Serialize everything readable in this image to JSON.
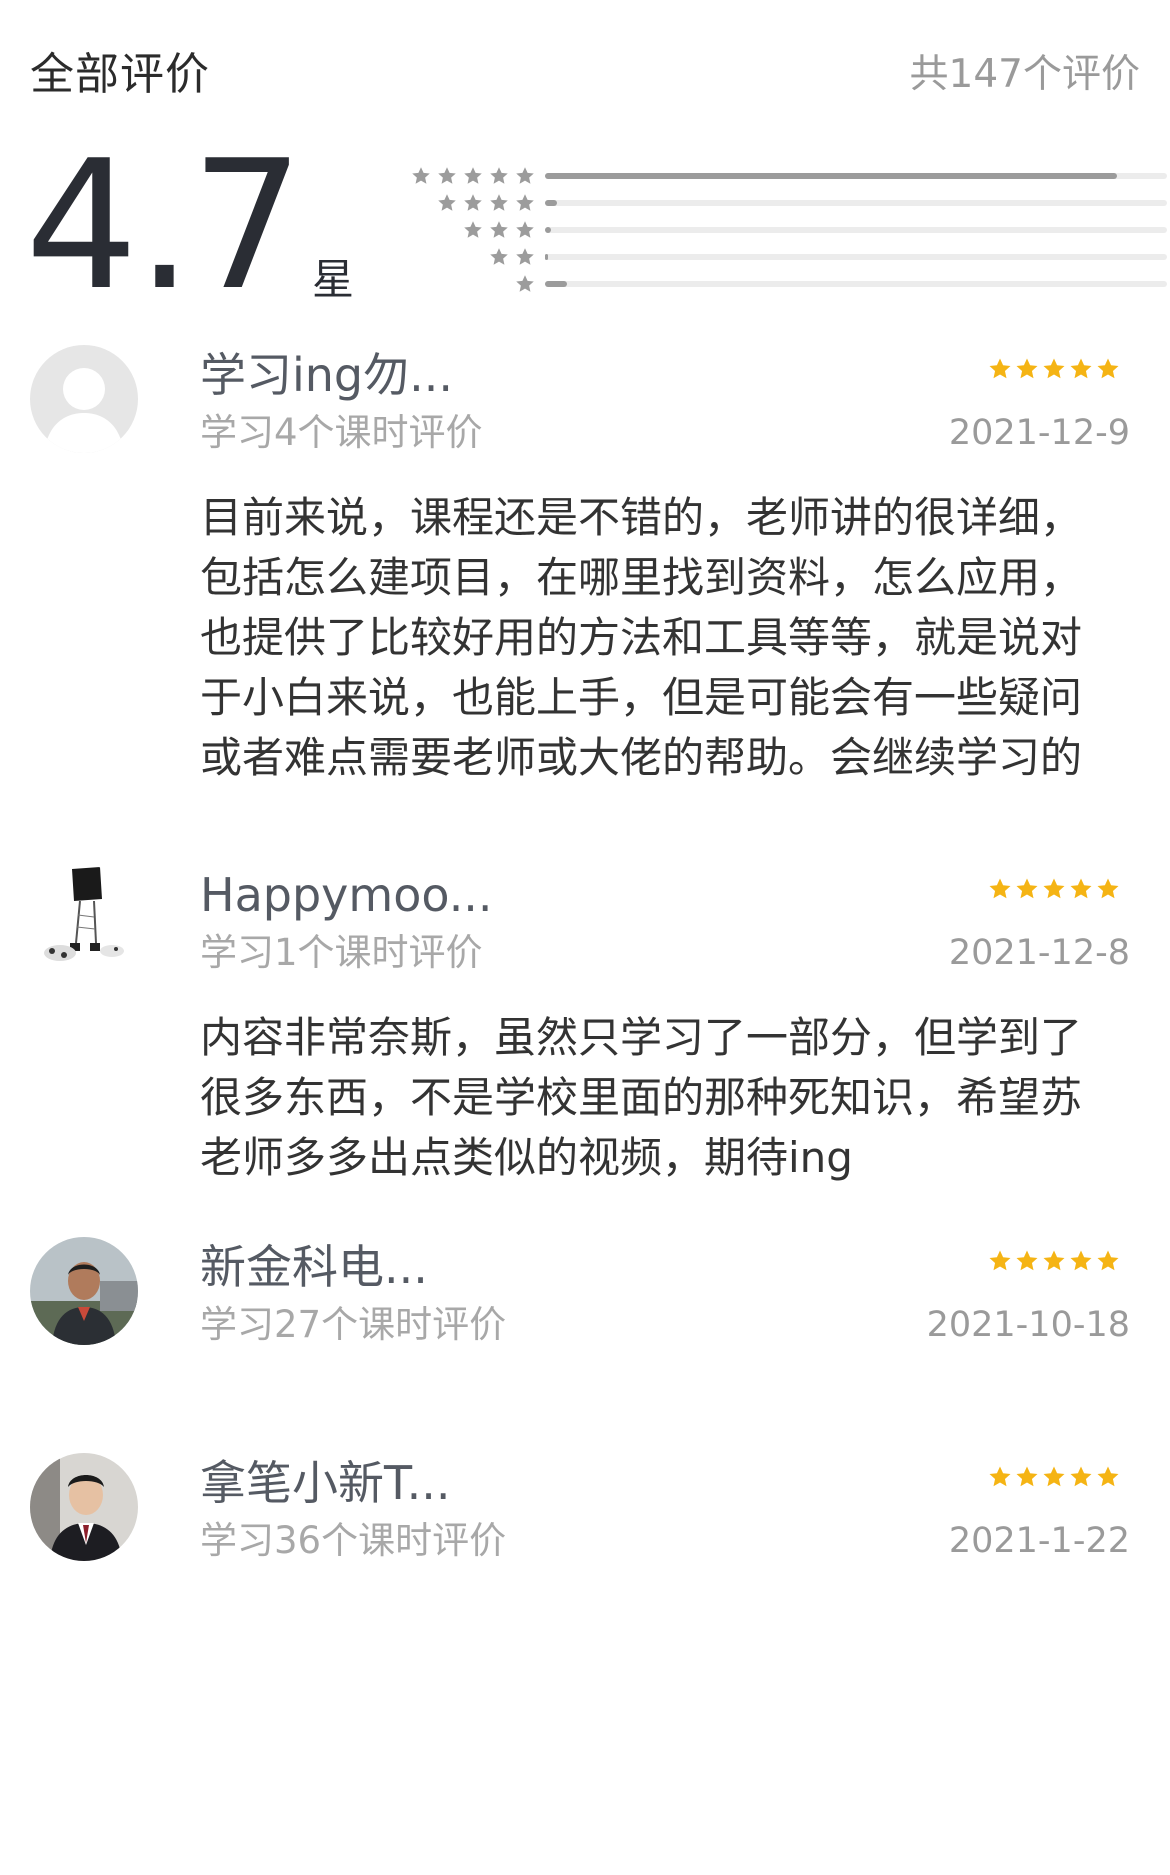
{
  "header": {
    "title": "全部评价",
    "count": "共147个评价"
  },
  "summary": {
    "score": "4.7",
    "unit": "星",
    "distribution": [
      {
        "stars": 5,
        "fraction": 0.92
      },
      {
        "stars": 4,
        "fraction": 0.02
      },
      {
        "stars": 3,
        "fraction": 0.01
      },
      {
        "stars": 2,
        "fraction": 0.005
      },
      {
        "stars": 1,
        "fraction": 0.035
      }
    ]
  },
  "colors": {
    "star_gold": "#f5b414",
    "mini_star_grey": "#9c9c9c",
    "bar_fill": "#9b9b9b",
    "bar_track": "#ececec"
  },
  "reviews": [
    {
      "name": "学习ing勿...",
      "avatar_icon": "default-user-icon",
      "rating": 5,
      "study": "学习4个课时评价",
      "date": "2021-12-9",
      "text": "目前来说，课程还是不错的，老师讲的很详细，包括怎么建项目，在哪里找到资料，怎么应用，也提供了比较好用的方法和工具等等，就是说对于小白来说，也能上手，但是可能会有一些疑问或者难点需要老师或大佬的帮助。会继续学习的"
    },
    {
      "name": "Happymoo...",
      "avatar_icon": "sketch-figure-icon",
      "rating": 5,
      "study": "学习1个课时评价",
      "date": "2021-12-8",
      "text": "内容非常奈斯，虽然只学习了一部分，但学到了很多东西，不是学校里面的那种死知识，希望苏老师多多出点类似的视频，期待ing"
    },
    {
      "name": "新金科电...",
      "avatar_icon": "user-photo-icon",
      "rating": 5,
      "study": "学习27个课时评价",
      "date": "2021-10-18",
      "text": ""
    },
    {
      "name": "拿笔小新T...",
      "avatar_icon": "user-photo-suit-icon",
      "rating": 5,
      "study": "学习36个课时评价",
      "date": "2021-1-22",
      "text": ""
    }
  ]
}
